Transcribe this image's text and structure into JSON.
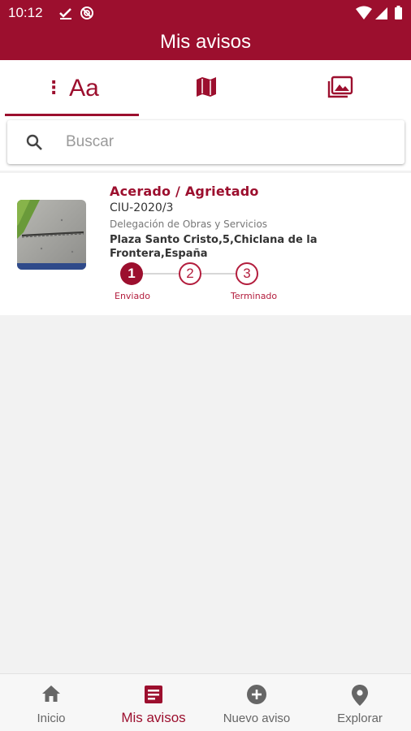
{
  "status_bar": {
    "time": "10:12"
  },
  "app_bar": {
    "title": "Mis avisos"
  },
  "tabs": [
    {
      "name": "list",
      "dots": "⋮",
      "label": "Aa",
      "active": true
    },
    {
      "name": "map",
      "icon": "map-icon"
    },
    {
      "name": "photos",
      "icon": "photo-library-icon"
    }
  ],
  "search": {
    "placeholder": "Buscar",
    "value": ""
  },
  "notices": [
    {
      "category": "Acerado / Agrietado",
      "code": "CIU-2020/3",
      "department": "Delegación de Obras y Servicios",
      "address": "Plaza Santo Cristo,5,Chiclana de la Frontera,España",
      "steps": [
        {
          "number": "1",
          "label": "Enviado",
          "status": "done"
        },
        {
          "number": "2",
          "label": "",
          "status": "pending"
        },
        {
          "number": "3",
          "label": "Terminado",
          "status": "pending"
        }
      ]
    }
  ],
  "bottom_nav": [
    {
      "label": "Inicio",
      "icon": "home-icon",
      "active": false
    },
    {
      "label": "Mis avisos",
      "icon": "notes-icon",
      "active": true
    },
    {
      "label": "Nuevo aviso",
      "icon": "add-circle-icon",
      "active": false
    },
    {
      "label": "Explorar",
      "icon": "location-pin-icon",
      "active": false
    }
  ],
  "colors": {
    "primary": "#9c0f2e",
    "background": "#f2f2f2"
  }
}
